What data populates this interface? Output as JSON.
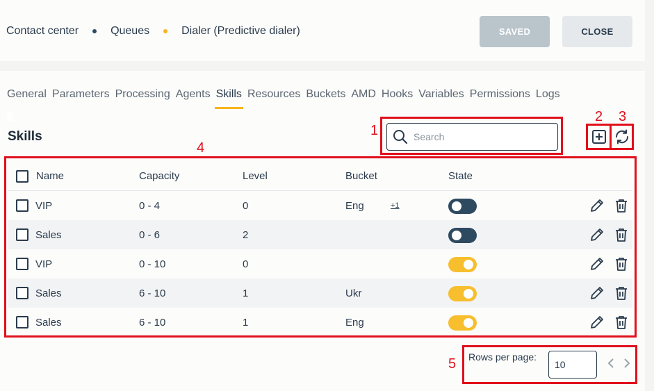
{
  "header": {
    "breadcrumb": [
      "Contact center",
      "Queues",
      "Dialer (Predictive dialer)"
    ],
    "saved_label": "SAVED",
    "close_label": "CLOSE"
  },
  "tabs": [
    "General",
    "Parameters",
    "Processing",
    "Agents",
    "Skills",
    "Resources",
    "Buckets",
    "AMD",
    "Hooks",
    "Variables",
    "Permissions",
    "Logs"
  ],
  "active_tab": "Skills",
  "section": {
    "title": "Skills"
  },
  "search": {
    "placeholder": "Search",
    "value": ""
  },
  "table": {
    "columns": [
      "Name",
      "Capacity",
      "Level",
      "Bucket",
      "State"
    ],
    "rows": [
      {
        "name": "VIP",
        "capacity": "0 - 4",
        "level": "0",
        "bucket": "Eng",
        "more": "+1",
        "state": "off"
      },
      {
        "name": "Sales",
        "capacity": "0 - 6",
        "level": "2",
        "bucket": "",
        "more": "",
        "state": "off"
      },
      {
        "name": "VIP",
        "capacity": "0 - 10",
        "level": "0",
        "bucket": "",
        "more": "",
        "state": "on"
      },
      {
        "name": "Sales",
        "capacity": "6 - 10",
        "level": "1",
        "bucket": "Ukr",
        "more": "",
        "state": "on"
      },
      {
        "name": "Sales",
        "capacity": "6 - 10",
        "level": "1",
        "bucket": "Eng",
        "more": "",
        "state": "on"
      }
    ]
  },
  "pagination": {
    "rows_per_page_label": "Rows per page:",
    "rows_per_page_value": "10"
  },
  "annotations": [
    "1",
    "2",
    "3",
    "4",
    "5"
  ],
  "colors": {
    "accent": "#f7b51e",
    "primary_dark": "#2a3b4c",
    "toggle_off": "#2e4a60",
    "toggle_on": "#f7be2e",
    "annotation_red": "#e0101c",
    "dot_queues": "#2e4a60",
    "dot_dialer": "#f7b51e"
  }
}
